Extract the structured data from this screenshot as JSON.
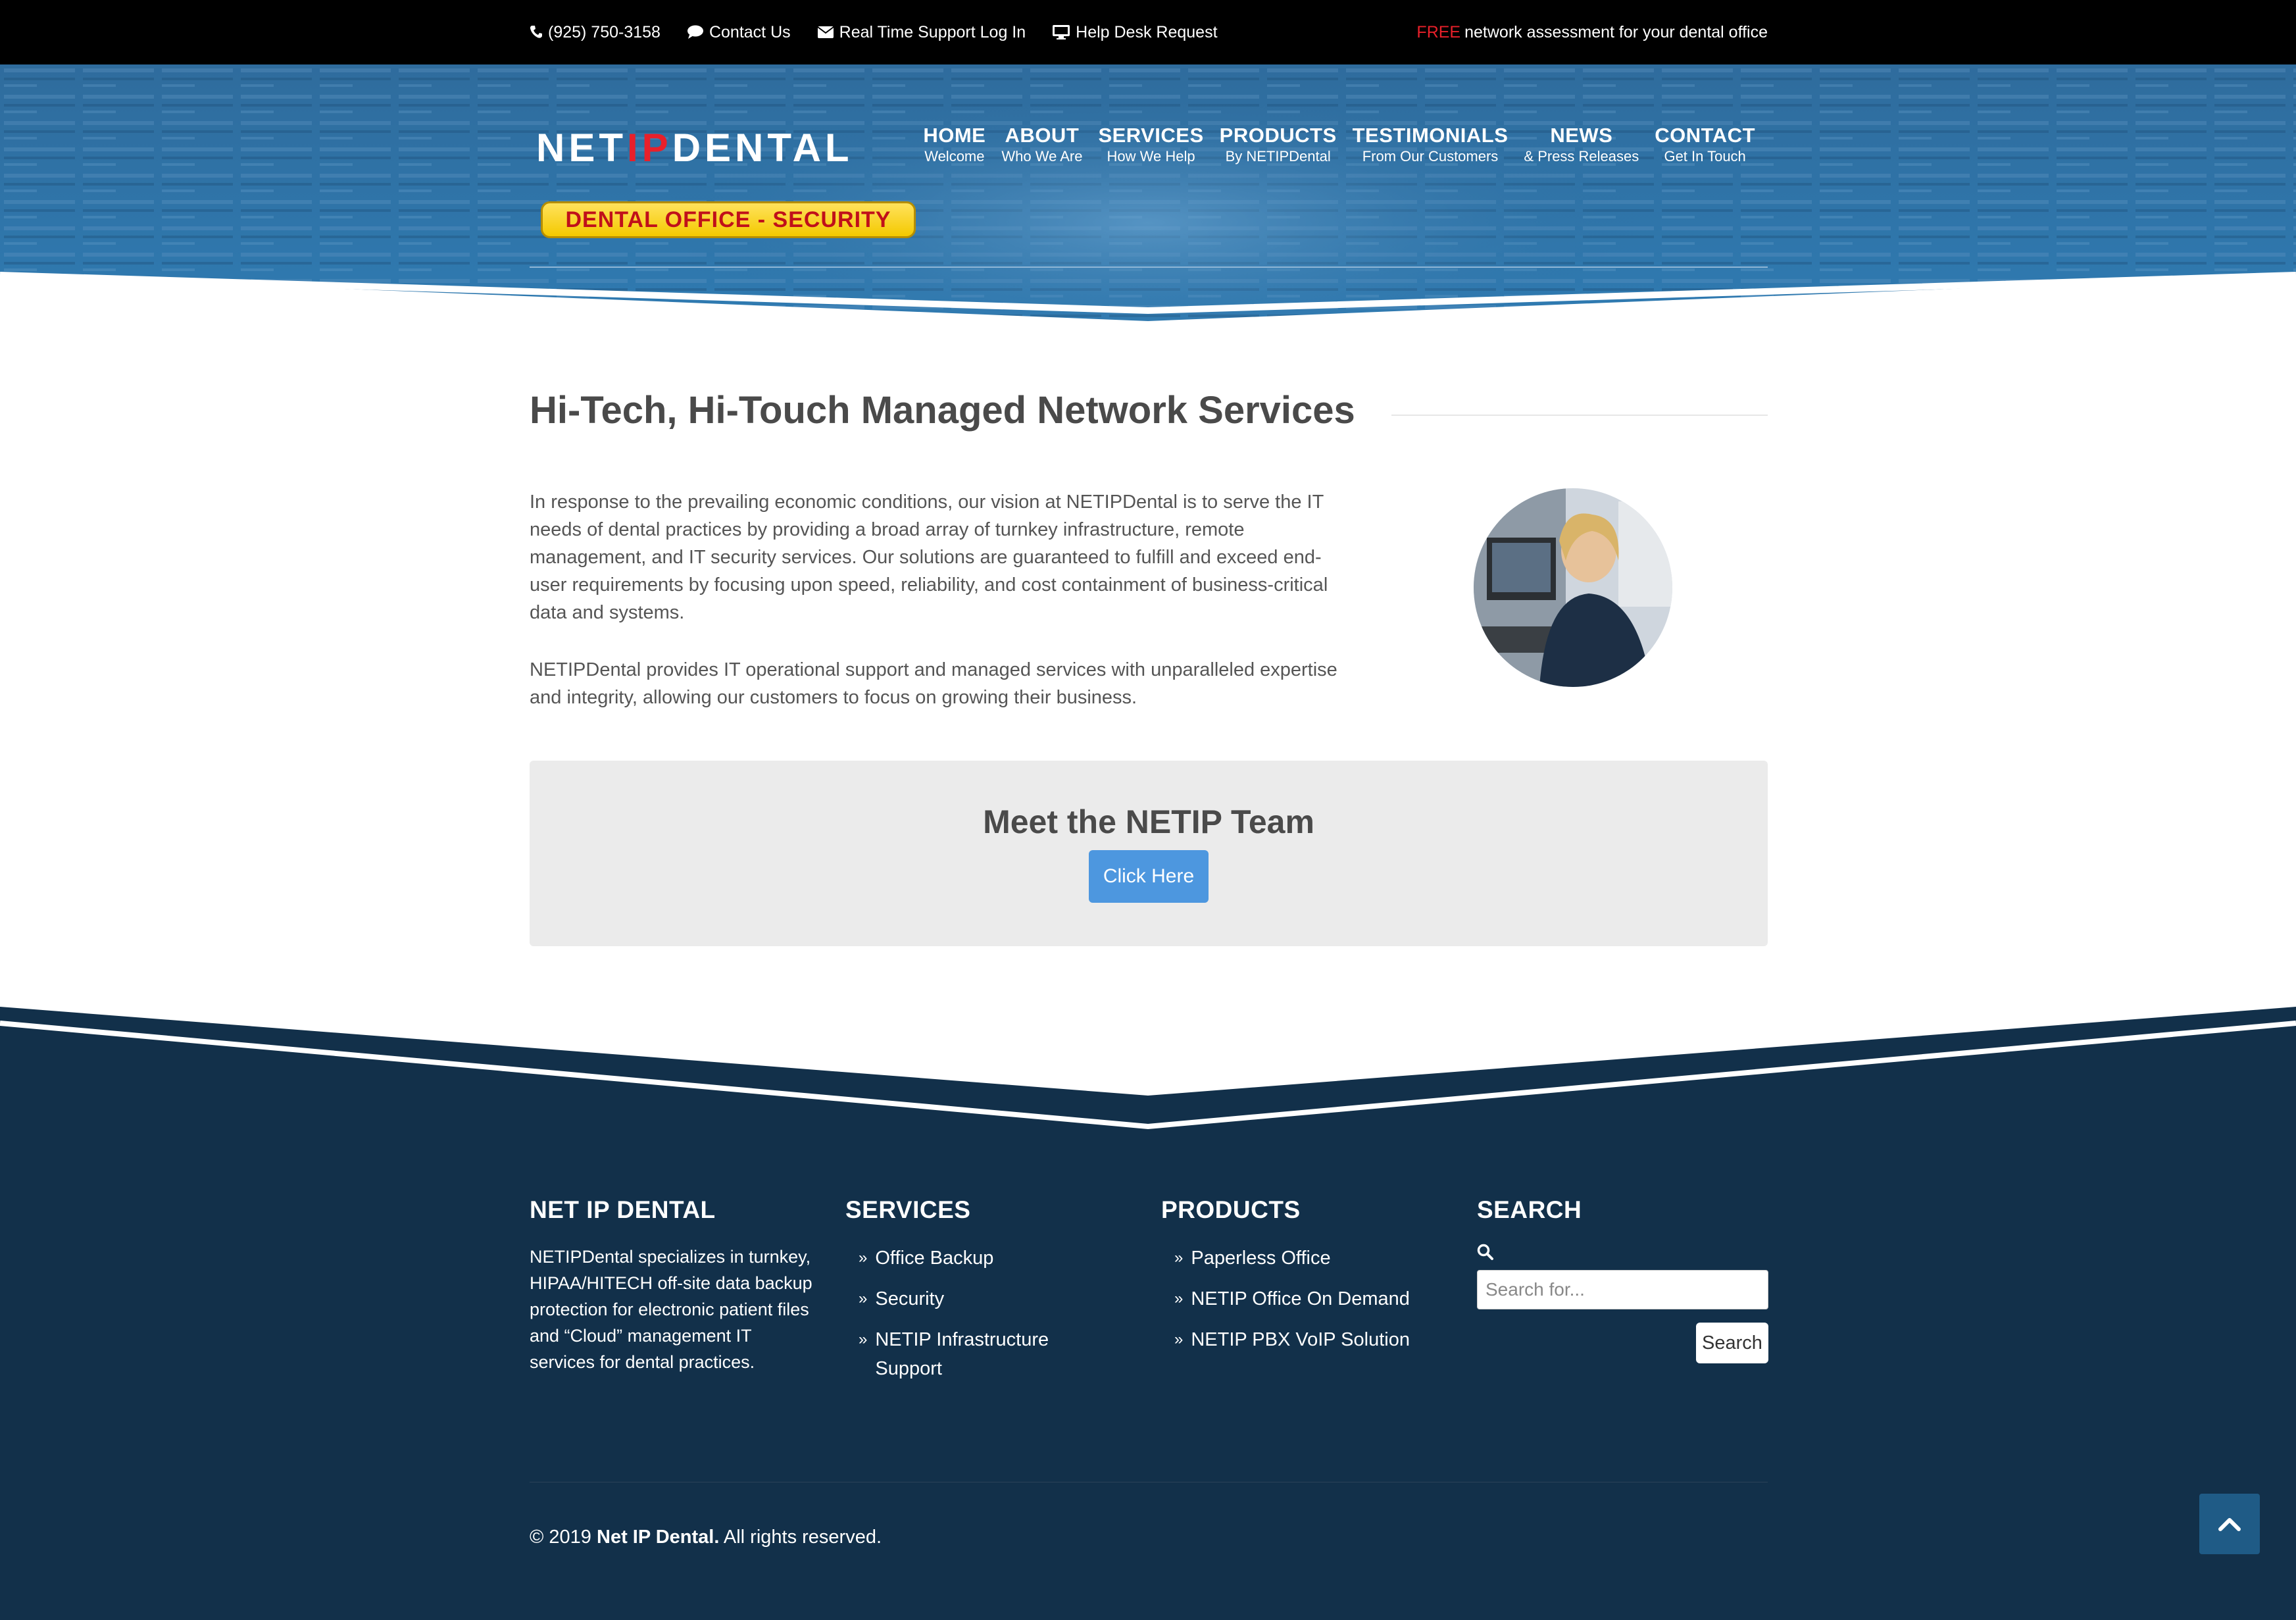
{
  "topbar": {
    "phone": "(925) 750-3158",
    "contact": "Contact Us",
    "support": "Real Time Support Log In",
    "helpdesk": "Help Desk Request",
    "free": "FREE",
    "free_rest": "network assessment for your dental office"
  },
  "header": {
    "logo_net": "NET",
    "logo_ip": "IP",
    "logo_dental": "DENTAL",
    "badge": "DENTAL OFFICE - SECURITY",
    "nav": [
      {
        "label": "HOME",
        "sub": "Welcome"
      },
      {
        "label": "ABOUT",
        "sub": "Who We Are"
      },
      {
        "label": "SERVICES",
        "sub": "How We Help"
      },
      {
        "label": "PRODUCTS",
        "sub": "By NETIPDental"
      },
      {
        "label": "TESTIMONIALS",
        "sub": "From Our Customers"
      },
      {
        "label": "NEWS",
        "sub": "& Press Releases"
      },
      {
        "label": "CONTACT",
        "sub": "Get In Touch"
      }
    ]
  },
  "main": {
    "title": "Hi-Tech, Hi-Touch Managed Network Services",
    "p1": "In response to the prevailing economic conditions, our vision at NETIPDental is to serve the IT needs of dental practices by providing a broad array of turnkey infrastructure, remote management, and IT security services. Our solutions are guaranteed to fulfill and exceed end-user requirements by focusing upon speed, reliability, and cost containment of business-critical data and systems.",
    "p2": "NETIPDental provides IT operational support and managed services with unparalleled expertise and integrity, allowing our customers to focus on growing their business.",
    "team_title": "Meet the NETIP Team",
    "team_button": "Click Here"
  },
  "footer": {
    "col1_title": "NET IP DENTAL",
    "col1_text": "NETIPDental specializes in turnkey, HIPAA/HITECH off-site data backup protection for electronic patient files and “Cloud” management IT services for dental practices.",
    "services_title": "SERVICES",
    "services": [
      "Office Backup",
      "Security",
      "NETIP Infrastructure Support"
    ],
    "products_title": "PRODUCTS",
    "products": [
      "Paperless Office",
      "NETIP Office On Demand",
      "NETIP PBX VoIP Solution"
    ],
    "search_title": "SEARCH",
    "search_placeholder": "Search for...",
    "search_button": "Search",
    "copyright_prefix": "© 2019",
    "copyright_name": "Net IP Dental.",
    "copyright_suffix": "All rights reserved."
  },
  "colors": {
    "accent_red": "#e8202a",
    "header_blue": "#2c6a9a",
    "footer_navy": "#12304a",
    "button_blue": "#4d97df"
  }
}
